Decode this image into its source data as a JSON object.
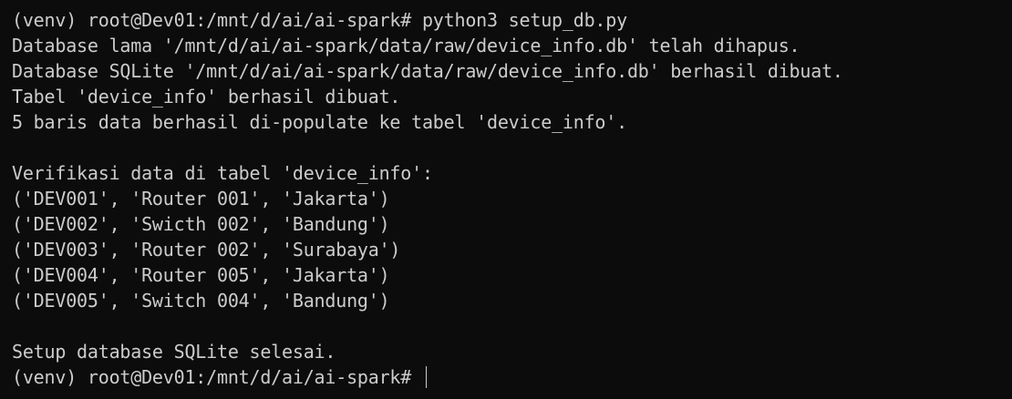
{
  "terminal": {
    "prompt_initial": "(venv) root@Dev01:/mnt/d/ai/ai-spark# python3 setup_db.py",
    "output": [
      "Database lama '/mnt/d/ai/ai-spark/data/raw/device_info.db' telah dihapus.",
      "Database SQLite '/mnt/d/ai/ai-spark/data/raw/device_info.db' berhasil dibuat.",
      "Tabel 'device_info' berhasil dibuat.",
      "5 baris data berhasil di-populate ke tabel 'device_info'.",
      "",
      "Verifikasi data di tabel 'device_info':",
      "('DEV001', 'Router 001', 'Jakarta')",
      "('DEV002', 'Swicth 002', 'Bandung')",
      "('DEV003', 'Router 002', 'Surabaya')",
      "('DEV004', 'Router 005', 'Jakarta')",
      "('DEV005', 'Switch 004', 'Bandung')",
      "",
      "Setup database SQLite selesai."
    ],
    "prompt_current": "(venv) root@Dev01:/mnt/d/ai/ai-spark# "
  }
}
